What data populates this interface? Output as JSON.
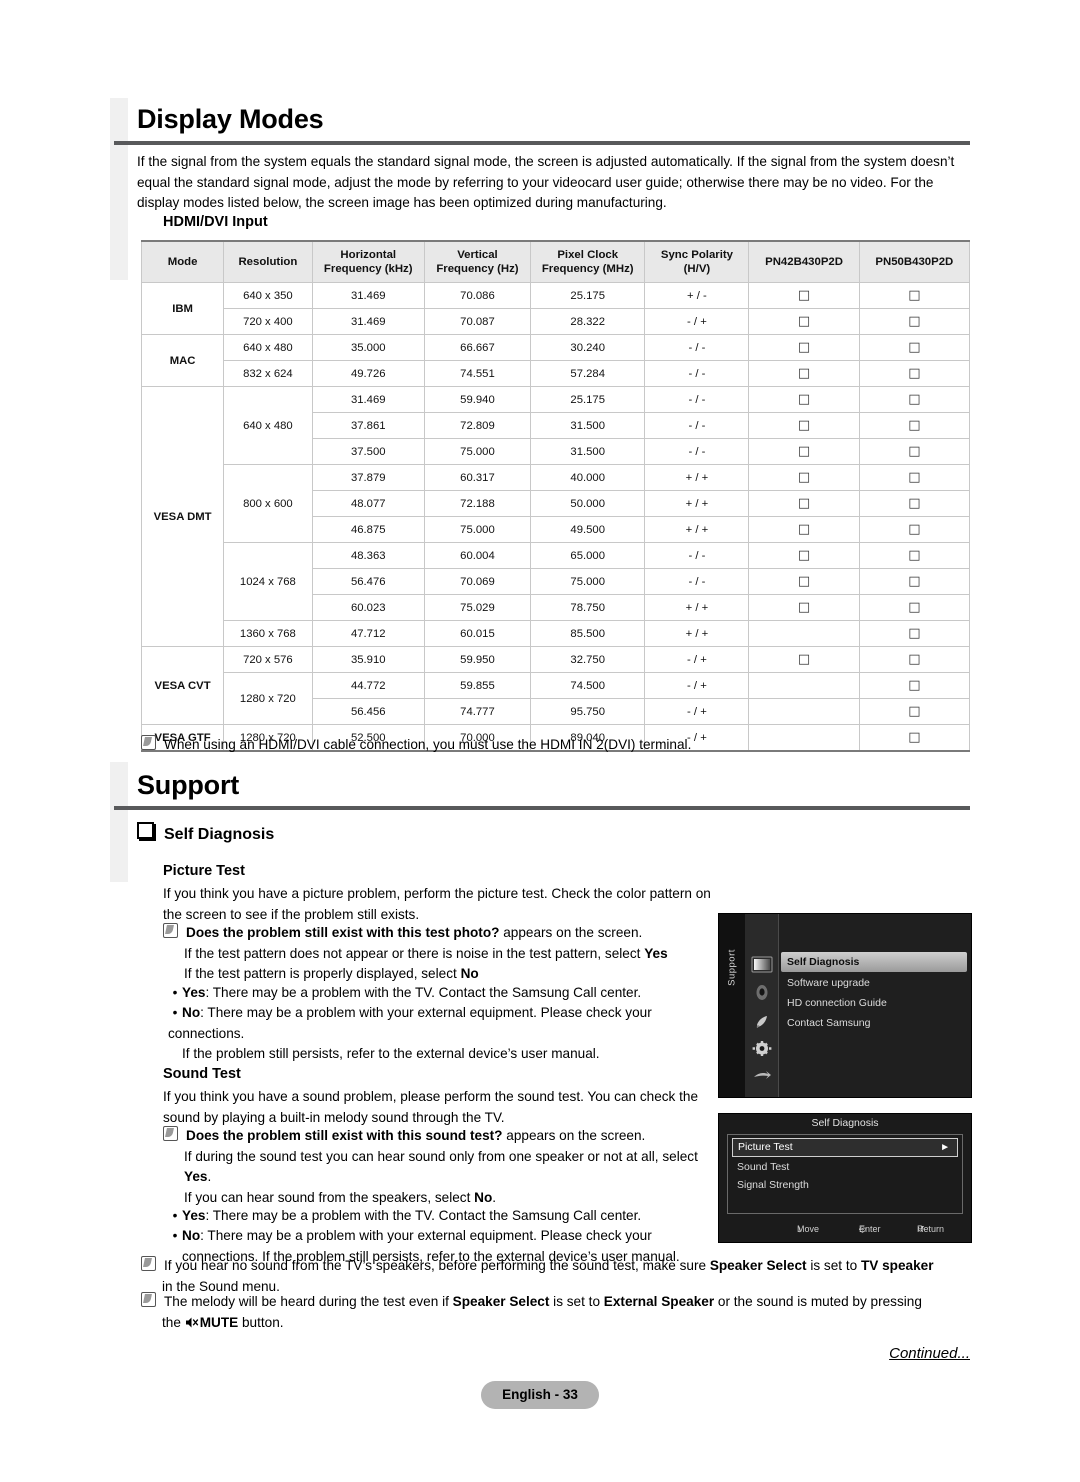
{
  "sections": {
    "display_modes": {
      "title": "Display Modes",
      "intro": "If the signal from the system equals the standard signal mode, the screen is adjusted automatically. If the signal from the system doesn’t equal the standard signal mode, adjust the mode by referring to your videocard user guide; otherwise there may be no video. For the display modes listed below, the screen image has been optimized during manufacturing.",
      "table_label": "HDMI/DVI Input",
      "note": "When using an HDMI/DVI cable connection, you must use the HDMI IN 2(DVI) terminal."
    },
    "support": {
      "title": "Support",
      "self_diagnosis": "Self Diagnosis",
      "picture_test": {
        "heading": "Picture Test",
        "intro": "If you think you have a picture problem, perform the picture test. Check the color pattern on the screen to see if the problem still exists.",
        "note_bold": "Does the problem still exist with this test photo?",
        "note_rest": " appears on the screen.",
        "note_line2_a": "If the test pattern does not appear or there is noise in the test pattern, select ",
        "note_line2_b": "Yes",
        "note_line3_a": "If the test pattern is properly displayed, select ",
        "note_line3_b": "No",
        "bullet_yes_label": "Yes",
        "bullet_yes_text": ": There may be a problem with the TV. Contact the Samsung Call center.",
        "bullet_no_label": "No",
        "bullet_no_text": ": There may be a problem with your external equipment. Please check your connections.",
        "bullet_no_line2": "If the problem still persists, refer to the external device’s user manual."
      },
      "sound_test": {
        "heading": "Sound Test",
        "intro": "If you think you have a sound problem, please perform the sound test. You can check the sound by playing a built-in melody sound through the TV.",
        "note_bold": "Does the problem still exist with this sound test?",
        "note_rest": " appears on the screen.",
        "note_line2_a": "If during the sound test you can hear sound only from one speaker or not at all, select",
        "note_line3_b": "Yes",
        "note_line3_rest": ".",
        "note_line4_a": "If you can hear sound from the speakers, select ",
        "note_line4_b": "No",
        "note_line4_rest": ".",
        "bullet_yes_label": "Yes",
        "bullet_yes_text": ": There may be a problem with the TV. Contact the Samsung Call center.",
        "bullet_no_label": "No",
        "bullet_no_text": ": There may be a problem with your external equipment. Please check your",
        "bullet_no_line2": "connections. If the problem still persists, refer to the external device’s user manual."
      },
      "final_notes": {
        "note1_a": "If you hear no sound from the TV’s speakers, before performing the sound test, make sure ",
        "note1_b": "Speaker Select",
        "note1_c": " is set to ",
        "note1_d": "TV speaker",
        "note1_e": "in the Sound menu.",
        "note2_a": "The melody will be heard during the test even if ",
        "note2_b": "Speaker Select",
        "note2_c": " is set to ",
        "note2_d": "External Speaker",
        "note2_e": " or the sound is muted by pressing",
        "note2_f": "the ",
        "note2_g": "MUTE",
        "note2_h": " button."
      }
    }
  },
  "osd_support_menu": {
    "tab_label": "Support",
    "items": [
      {
        "label": "Self Diagnosis",
        "selected": true
      },
      {
        "label": "Software upgrade",
        "selected": false
      },
      {
        "label": "HD connection Guide",
        "selected": false
      },
      {
        "label": "Contact Samsung",
        "selected": false
      }
    ],
    "icons": [
      "picture-icon",
      "sound-icon",
      "channel-icon",
      "setup-icon",
      "input-icon",
      "support-icon"
    ]
  },
  "osd_self_diagnosis": {
    "title": "Self Diagnosis",
    "items": [
      {
        "label": "Picture Test",
        "selected": true,
        "arrow": "►"
      },
      {
        "label": "Sound Test",
        "selected": false,
        "arrow": ""
      },
      {
        "label": "Signal Strength",
        "selected": false,
        "arrow": ""
      }
    ],
    "footer": {
      "move": "Move",
      "enter": "Enter",
      "return": "Return"
    }
  },
  "footer": {
    "continued": "Continued...",
    "page": "English - 33"
  },
  "table": {
    "headers": [
      "Mode",
      "Resolution",
      "Horizontal\nFrequency (kHz)",
      "Vertical\nFrequency (Hz)",
      "Pixel Clock\nFrequency (MHz)",
      "Sync Polarity\n(H/V)",
      "PN42B430P2D",
      "PN50B430P2D"
    ],
    "headers_split": [
      {
        "l1": "Mode",
        "l2": ""
      },
      {
        "l1": "Resolution",
        "l2": ""
      },
      {
        "l1": "Horizontal",
        "l2": "Frequency (kHz)"
      },
      {
        "l1": "Vertical",
        "l2": "Frequency (Hz)"
      },
      {
        "l1": "Pixel Clock",
        "l2": "Frequency (MHz)"
      },
      {
        "l1": "Sync Polarity",
        "l2": "(H/V)"
      },
      {
        "l1": "PN42B430P2D",
        "l2": ""
      },
      {
        "l1": "PN50B430P2D",
        "l2": ""
      }
    ],
    "tick": "□",
    "rows": [
      {
        "mode": "IBM",
        "mode_span": 2,
        "res": "640 x 350",
        "res_span": 1,
        "h": "31.469",
        "v": "70.086",
        "p": "25.175",
        "s": "+ / -",
        "c1": true,
        "c2": true,
        "group_start": true
      },
      {
        "mode": "",
        "mode_span": 0,
        "res": "720 x 400",
        "res_span": 1,
        "h": "31.469",
        "v": "70.087",
        "p": "28.322",
        "s": "- / +",
        "c1": true,
        "c2": true
      },
      {
        "mode": "MAC",
        "mode_span": 2,
        "res": "640 x 480",
        "res_span": 1,
        "h": "35.000",
        "v": "66.667",
        "p": "30.240",
        "s": "- / -",
        "c1": true,
        "c2": true,
        "group_start": true
      },
      {
        "mode": "",
        "mode_span": 0,
        "res": "832 x 624",
        "res_span": 1,
        "h": "49.726",
        "v": "74.551",
        "p": "57.284",
        "s": "- / -",
        "c1": true,
        "c2": true
      },
      {
        "mode": "VESA DMT",
        "mode_span": 10,
        "res": "640 x 480",
        "res_span": 3,
        "h": "31.469",
        "v": "59.940",
        "p": "25.175",
        "s": "- / -",
        "c1": true,
        "c2": true,
        "group_start": true
      },
      {
        "mode": "",
        "mode_span": 0,
        "res": "",
        "res_span": 0,
        "h": "37.861",
        "v": "72.809",
        "p": "31.500",
        "s": "- / -",
        "c1": true,
        "c2": true
      },
      {
        "mode": "",
        "mode_span": 0,
        "res": "",
        "res_span": 0,
        "h": "37.500",
        "v": "75.000",
        "p": "31.500",
        "s": "- / -",
        "c1": true,
        "c2": true
      },
      {
        "mode": "",
        "mode_span": 0,
        "res": "800 x 600",
        "res_span": 3,
        "h": "37.879",
        "v": "60.317",
        "p": "40.000",
        "s": "+ / +",
        "c1": true,
        "c2": true
      },
      {
        "mode": "",
        "mode_span": 0,
        "res": "",
        "res_span": 0,
        "h": "48.077",
        "v": "72.188",
        "p": "50.000",
        "s": "+ / +",
        "c1": true,
        "c2": true
      },
      {
        "mode": "",
        "mode_span": 0,
        "res": "",
        "res_span": 0,
        "h": "46.875",
        "v": "75.000",
        "p": "49.500",
        "s": "+ / +",
        "c1": true,
        "c2": true
      },
      {
        "mode": "",
        "mode_span": 0,
        "res": "1024 x 768",
        "res_span": 3,
        "h": "48.363",
        "v": "60.004",
        "p": "65.000",
        "s": "- / -",
        "c1": true,
        "c2": true
      },
      {
        "mode": "",
        "mode_span": 0,
        "res": "",
        "res_span": 0,
        "h": "56.476",
        "v": "70.069",
        "p": "75.000",
        "s": "- / -",
        "c1": true,
        "c2": true
      },
      {
        "mode": "",
        "mode_span": 0,
        "res": "",
        "res_span": 0,
        "h": "60.023",
        "v": "75.029",
        "p": "78.750",
        "s": "+ / +",
        "c1": true,
        "c2": true
      },
      {
        "mode": "",
        "mode_span": 0,
        "res": "1360 x 768",
        "res_span": 1,
        "h": "47.712",
        "v": "60.015",
        "p": "85.500",
        "s": "+ / +",
        "c1": false,
        "c2": true
      },
      {
        "mode": "VESA CVT",
        "mode_span": 3,
        "res": "720 x 576",
        "res_span": 1,
        "h": "35.910",
        "v": "59.950",
        "p": "32.750",
        "s": "- / +",
        "c1": true,
        "c2": true,
        "group_start": true
      },
      {
        "mode": "",
        "mode_span": 0,
        "res": "1280 x 720",
        "res_span": 2,
        "h": "44.772",
        "v": "59.855",
        "p": "74.500",
        "s": "- / +",
        "c1": false,
        "c2": true
      },
      {
        "mode": "",
        "mode_span": 0,
        "res": "",
        "res_span": 0,
        "h": "56.456",
        "v": "74.777",
        "p": "95.750",
        "s": "- / +",
        "c1": false,
        "c2": true
      },
      {
        "mode": "VESA GTF",
        "mode_span": 1,
        "res": "1280 x 720",
        "res_span": 1,
        "h": "52.500",
        "v": "70.000",
        "p": "89.040",
        "s": "- / +",
        "c1": false,
        "c2": true,
        "group_start": true
      }
    ]
  }
}
